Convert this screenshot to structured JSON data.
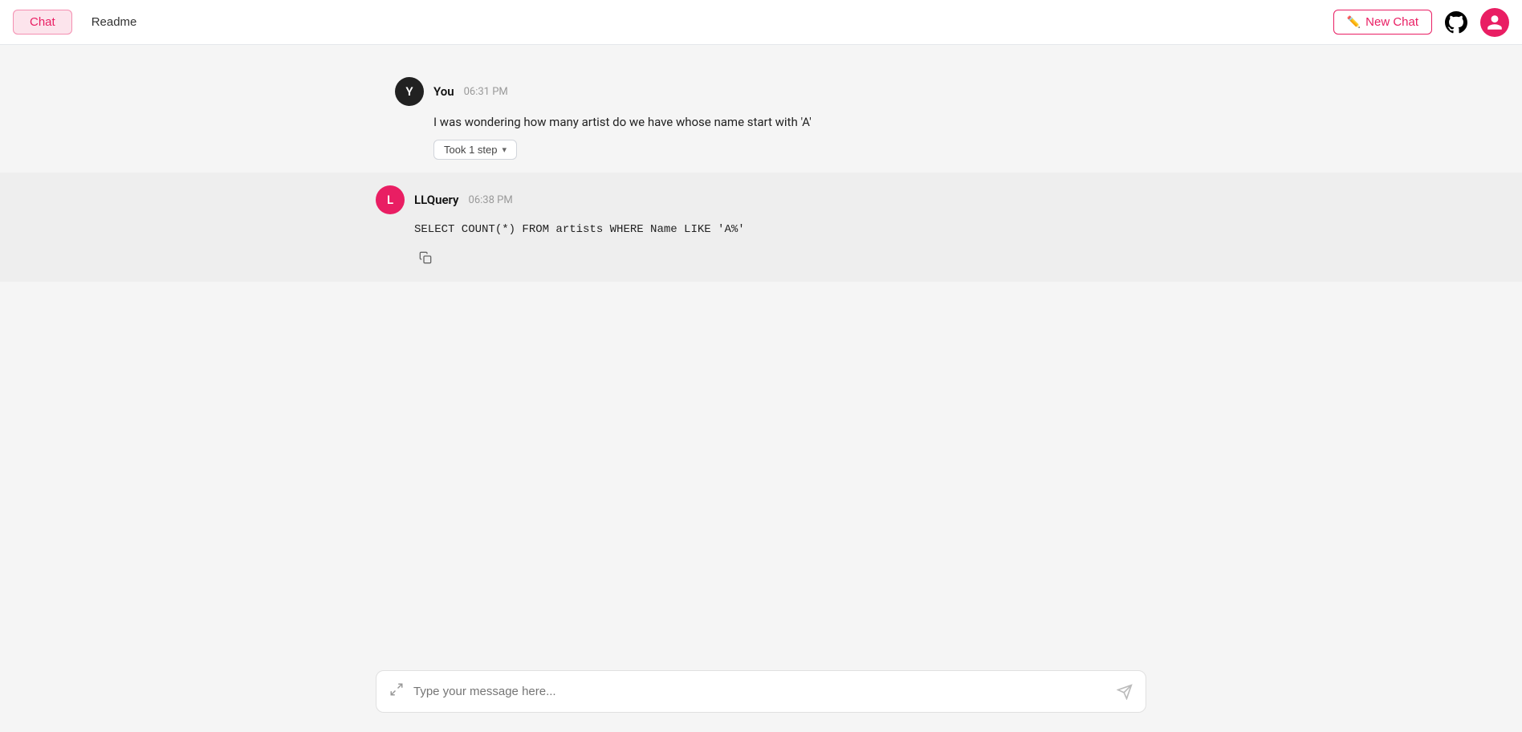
{
  "header": {
    "tab_chat_label": "Chat",
    "tab_readme_label": "Readme",
    "new_chat_label": "New Chat"
  },
  "messages": [
    {
      "id": "msg1",
      "sender": "You",
      "avatar_letter": "Y",
      "avatar_class": "avatar-you",
      "time": "06:31 PM",
      "text": "I was wondering how many artist do we have whose name start with 'A'",
      "badge": "Took 1 step",
      "type": "user"
    },
    {
      "id": "msg2",
      "sender": "LLQuery",
      "avatar_letter": "L",
      "avatar_class": "avatar-llquery",
      "time": "06:38 PM",
      "code": "SELECT COUNT(*) FROM artists WHERE Name LIKE 'A%'",
      "type": "assistant"
    }
  ],
  "input": {
    "placeholder": "Type your message here..."
  },
  "colors": {
    "accent": "#e91e63",
    "bg_tab_chat": "#fce4ec"
  }
}
